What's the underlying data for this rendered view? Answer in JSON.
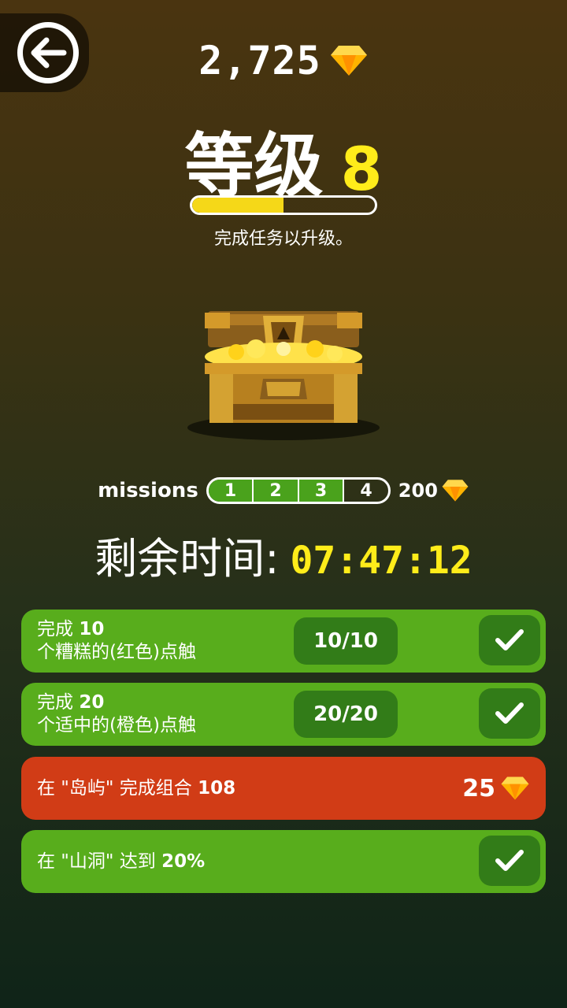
{
  "header": {
    "gem_total": "2,725",
    "level_label": "等级",
    "level_number": "8",
    "level_progress": 0.5,
    "hint": "完成任务以升级。"
  },
  "missions_progress": {
    "label": "missions",
    "segments": [
      "1",
      "2",
      "3",
      "4"
    ],
    "completed": 3,
    "reward": "200"
  },
  "timer": {
    "label": "剩余时间:",
    "value": "07:47:12"
  },
  "missions": [
    {
      "prefix": "完成",
      "number": "10",
      "line2": "个糟糕的(红色)点触",
      "count": "10/10",
      "status": "done",
      "color": "#58ad1c"
    },
    {
      "prefix": "完成",
      "number": "20",
      "line2": "个适中的(橙色)点触",
      "count": "20/20",
      "status": "done",
      "color": "#58ad1c"
    },
    {
      "text": "在 \"岛屿\" 完成组合",
      "number": "108",
      "reward": "25",
      "status": "pending",
      "color": "#d13c16"
    },
    {
      "text": "在 \"山洞\" 达到",
      "number": "20%",
      "status": "done",
      "color": "#58ad1c"
    }
  ],
  "icons": {
    "back": "back-arrow-icon",
    "gem": "gem-icon",
    "check": "check-icon",
    "chest": "treasure-chest"
  }
}
